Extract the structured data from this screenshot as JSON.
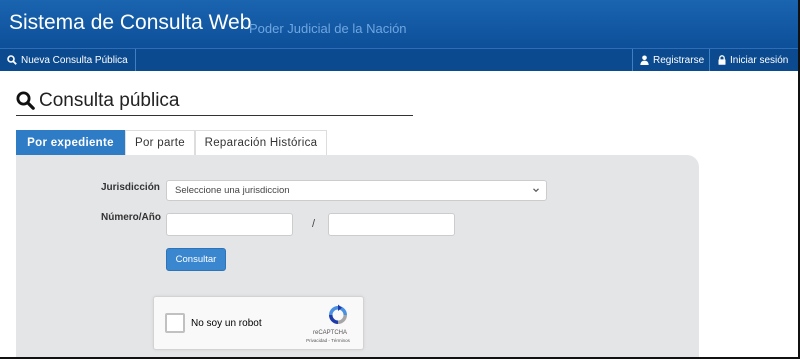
{
  "header": {
    "title": "Sistema de Consulta Web",
    "subtitle": "Poder Judicial de la Nación"
  },
  "nav": {
    "consulta": {
      "label": "Nueva Consulta Pública",
      "icon": "search-icon"
    },
    "registrarse": {
      "label": "Registrarse",
      "icon": "user-icon"
    },
    "iniciar_sesion": {
      "label": "Iniciar sesión",
      "icon": "lock-icon"
    }
  },
  "page": {
    "title": "Consulta pública",
    "icon": "search-icon"
  },
  "tabs": [
    {
      "label": "Por expediente",
      "active": true
    },
    {
      "label": "Por parte",
      "active": false
    },
    {
      "label": "Reparación Histórica",
      "active": false
    }
  ],
  "form": {
    "jurisdiccion_label": "Jurisdicción",
    "jurisdiccion_selected": "Seleccione una jurisdiccion",
    "numero_label": "Número/Año",
    "numero_value": "",
    "anio_value": "",
    "separator": "/",
    "submit_label": "Consultar"
  },
  "recaptcha": {
    "label": "No soy un robot",
    "brand": "reCAPTCHA",
    "terms": "Privacidad - Términos"
  },
  "colors": {
    "header_bg": "#0d4f99",
    "navbar_bg": "#0b4a8f",
    "subtitle": "#6fa6e0",
    "active_tab": "#2f7cc6",
    "button": "#3a87cf",
    "panel_bg": "#e4e5e7"
  }
}
